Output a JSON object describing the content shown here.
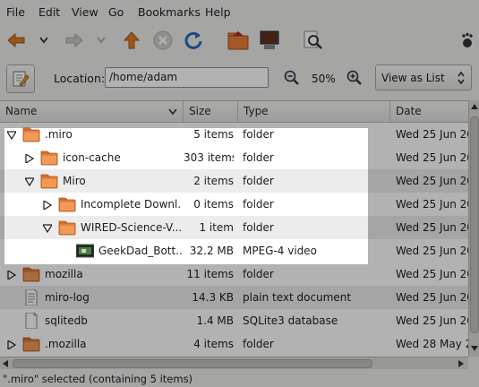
{
  "menu": {
    "file": "File",
    "edit": "Edit",
    "view": "View",
    "go": "Go",
    "bookmarks": "Bookmarks",
    "help": "Help"
  },
  "location": {
    "label": "Location:",
    "value": "/home/adam",
    "zoom": "50%",
    "view_mode": "View as List"
  },
  "columns": {
    "name": "Name",
    "size": "Size",
    "type": "Type",
    "date": "Date Modified"
  },
  "rows": [
    {
      "name": ".miro",
      "size": "5 items",
      "type": "folder",
      "date": "Wed 25 Jun 20",
      "icon": "folder-icon",
      "expander": "expanded"
    },
    {
      "name": "icon-cache",
      "size": "303 items",
      "type": "folder",
      "date": "Wed 25 Jun 20",
      "icon": "folder-icon",
      "expander": "collapsed"
    },
    {
      "name": "Miro",
      "size": "2 items",
      "type": "folder",
      "date": "Wed 25 Jun 20",
      "icon": "folder-icon",
      "expander": "expanded"
    },
    {
      "name": "Incomplete Downl...",
      "size": "0 items",
      "type": "folder",
      "date": "Wed 25 Jun 20",
      "icon": "folder-icon",
      "expander": "collapsed"
    },
    {
      "name": "WIRED-Science-V...",
      "size": "1 item",
      "type": "folder",
      "date": "Wed 25 Jun 20",
      "icon": "folder-icon",
      "expander": "expanded"
    },
    {
      "name": "GeekDad_Bott...",
      "size": "32.2 MB",
      "type": "MPEG-4 video",
      "date": "Wed 25 Jun 20",
      "icon": "video-thumbnail-icon",
      "expander": "none"
    },
    {
      "name": "mozilla",
      "size": "11 items",
      "type": "folder",
      "date": "Wed 25 Jun 20",
      "icon": "folder-icon",
      "expander": "collapsed"
    },
    {
      "name": "miro-log",
      "size": "14.3 KB",
      "type": "plain text document",
      "date": "Wed 25 Jun 20",
      "icon": "text-document-icon",
      "expander": "none"
    },
    {
      "name": "sqlitedb",
      "size": "1.4 MB",
      "type": "SQLite3 database",
      "date": "Wed 25 Jun 20",
      "icon": "document-icon",
      "expander": "none"
    },
    {
      "name": ".mozilla",
      "size": "4 items",
      "type": "folder",
      "date": "Wed 28 May 2",
      "icon": "folder-icon",
      "expander": "collapsed"
    }
  ],
  "status": "\".miro\" selected (containing 5 items)",
  "colors": {
    "folder": "#e8803a",
    "back_arrow": "#e07b25",
    "up_arrow": "#e07b25",
    "reload": "#2a66c0",
    "overlay": "rgba(0,0,0,0.30)"
  }
}
